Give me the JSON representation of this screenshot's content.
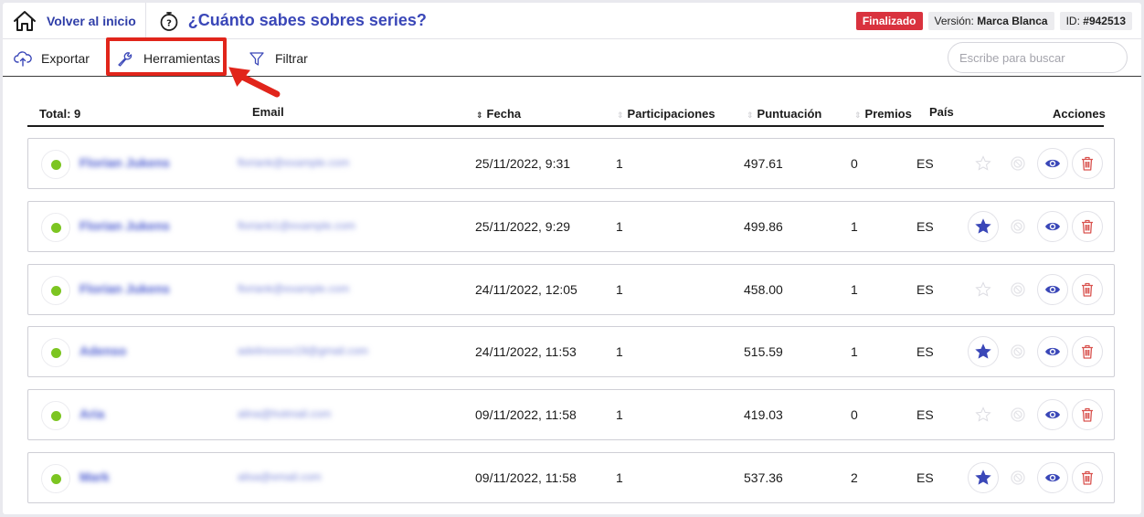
{
  "header": {
    "home_label": "Volver al inicio",
    "title": "¿Cuánto sabes sobres series?",
    "status": "Finalizado",
    "version_label": "Versión:",
    "version_value": "Marca Blanca",
    "id_label": "ID:",
    "id_value": "#942513"
  },
  "toolbar": {
    "export_label": "Exportar",
    "tools_label": "Herramientas",
    "filter_label": "Filtrar",
    "search_placeholder": "Escribe para buscar"
  },
  "table": {
    "headers": {
      "total": "Total: 9",
      "email": "Email",
      "date": "Fecha",
      "participations": "Participaciones",
      "score": "Puntuación",
      "prizes": "Premios",
      "country": "País",
      "actions": "Acciones"
    },
    "rows": [
      {
        "name": "Florian Jukens",
        "email": "floriank@example.com",
        "date": "25/11/2022, 9:31",
        "participations": "1",
        "score": "497.61",
        "prizes": "0",
        "country": "ES",
        "starred": false
      },
      {
        "name": "Florian Jukens",
        "email": "floriank1@example.com",
        "date": "25/11/2022, 9:29",
        "participations": "1",
        "score": "499.86",
        "prizes": "1",
        "country": "ES",
        "starred": true
      },
      {
        "name": "Florian Jukens",
        "email": "floriank@example.com",
        "date": "24/11/2022, 12:05",
        "participations": "1",
        "score": "458.00",
        "prizes": "1",
        "country": "ES",
        "starred": false
      },
      {
        "name": "Adenso",
        "email": "adelinoxxxx19@gmail.com",
        "date": "24/11/2022, 11:53",
        "participations": "1",
        "score": "515.59",
        "prizes": "1",
        "country": "ES",
        "starred": true
      },
      {
        "name": "Aria",
        "email": "alina@hotmail.com",
        "date": "09/11/2022, 11:58",
        "participations": "1",
        "score": "419.03",
        "prizes": "0",
        "country": "ES",
        "starred": false
      },
      {
        "name": "Mark",
        "email": "alisa@email.com",
        "date": "09/11/2022, 11:58",
        "participations": "1",
        "score": "537.36",
        "prizes": "2",
        "country": "ES",
        "starred": true
      }
    ]
  },
  "icons": {
    "home": "home-icon",
    "timer": "stopwatch-icon",
    "export": "cloud-upload-icon",
    "tools": "wrench-icon",
    "filter": "funnel-icon",
    "star": "star-icon",
    "prize": "medal-icon",
    "view": "eye-icon",
    "delete": "trash-icon"
  },
  "colors": {
    "accent": "#3a47b8",
    "status_red": "#d9323e",
    "online_green": "#7cc521",
    "delete_red": "#d9534f",
    "highlight_red": "#e1251b"
  }
}
